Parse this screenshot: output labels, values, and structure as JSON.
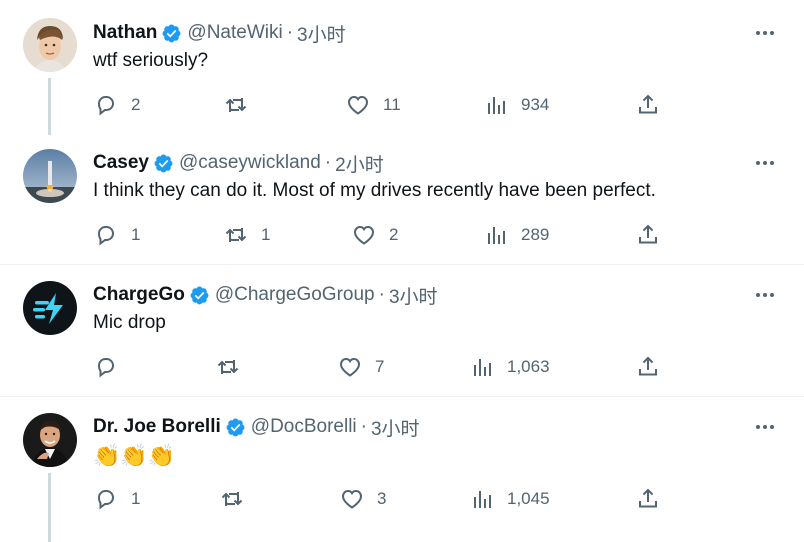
{
  "tweets": [
    {
      "name": "Nathan",
      "handle": "@NateWiki",
      "time": "3小时",
      "text": "wtf seriously?",
      "replies": "2",
      "retweets": "",
      "likes": "11",
      "views": "934"
    },
    {
      "name": "Casey",
      "handle": "@caseywickland",
      "time": "2小时",
      "text": "I think they can do it.  Most of my drives recently have been perfect.",
      "replies": "1",
      "retweets": "1",
      "likes": "2",
      "views": "289"
    },
    {
      "name": "ChargeGo",
      "handle": "@ChargeGoGroup",
      "time": "3小时",
      "text": "Mic drop",
      "replies": "",
      "retweets": "",
      "likes": "7",
      "views": "1,063"
    },
    {
      "name": "Dr. Joe Borelli",
      "handle": "@DocBorelli",
      "time": "3小时",
      "text": "👏👏👏",
      "replies": "1",
      "retweets": "",
      "likes": "3",
      "views": "1,045"
    }
  ],
  "dot": "·",
  "icons": {
    "reply": "reply-icon",
    "retweet": "retweet-icon",
    "like": "heart-icon",
    "views": "views-icon",
    "share": "share-icon",
    "more": "more-icon",
    "verified": "verified-badge-icon"
  },
  "colors": {
    "verified": "#1d9bf0",
    "muted": "#536471",
    "thread_line": "#cfd9de"
  }
}
